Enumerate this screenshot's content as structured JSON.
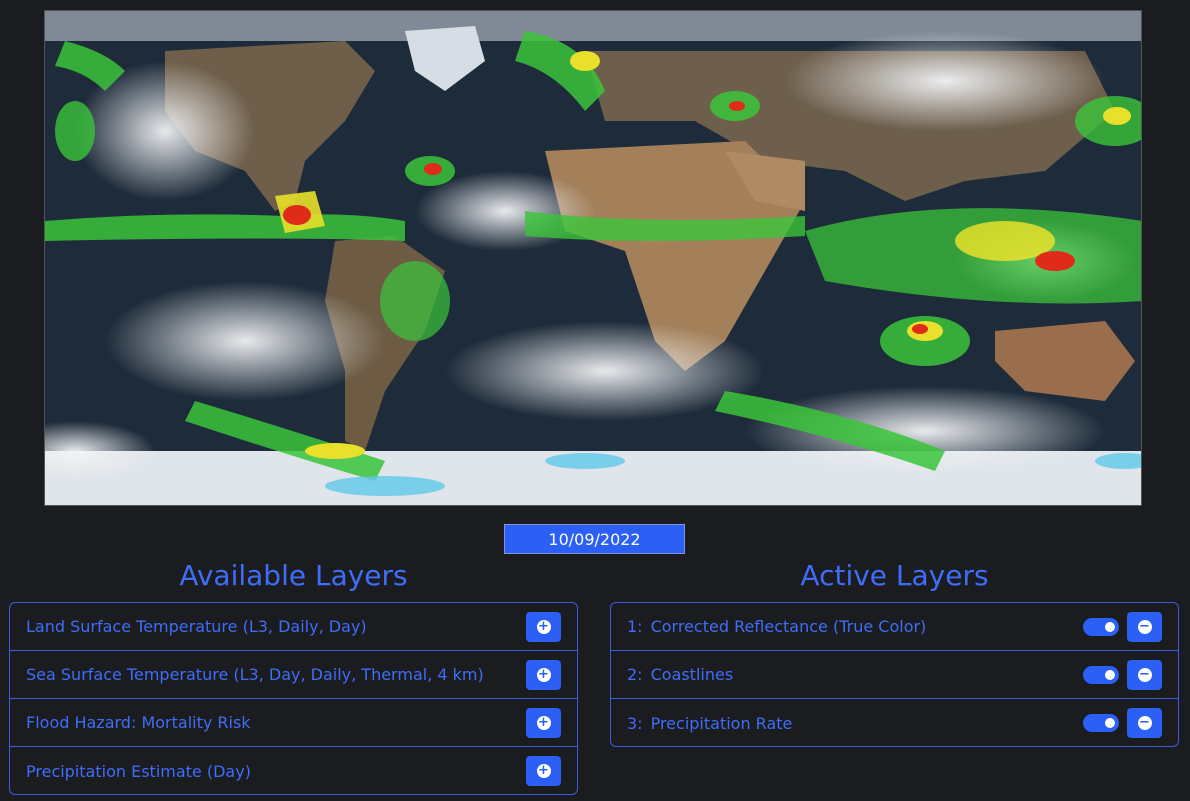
{
  "map": {
    "description_icon": "world-map-icon"
  },
  "date": {
    "value": "10/09/2022"
  },
  "available": {
    "title": "Available Layers",
    "items": [
      {
        "label": "Land Surface Temperature (L3, Daily, Day)",
        "action_icon": "plus-circle-icon"
      },
      {
        "label": "Sea Surface Temperature (L3, Day, Daily, Thermal, 4 km)",
        "action_icon": "plus-circle-icon"
      },
      {
        "label": "Flood Hazard: Mortality Risk",
        "action_icon": "plus-circle-icon"
      },
      {
        "label": "Precipitation Estimate (Day)",
        "action_icon": "plus-circle-icon"
      }
    ]
  },
  "active": {
    "title": "Active Layers",
    "items": [
      {
        "index": "1:",
        "label": "Corrected Reflectance (True Color)",
        "enabled": true,
        "action_icon": "minus-circle-icon"
      },
      {
        "index": "2:",
        "label": "Coastlines",
        "enabled": true,
        "action_icon": "minus-circle-icon"
      },
      {
        "index": "3:",
        "label": "Precipitation Rate",
        "enabled": true,
        "action_icon": "minus-circle-icon"
      }
    ]
  },
  "colors": {
    "accent": "#2b5ff5",
    "text_accent": "#3f6df7",
    "background": "#1b1c20",
    "land": "#7a6650",
    "desert": "#b08a62",
    "precip_green": "#3bc43b",
    "precip_yellow": "#e8e02a",
    "precip_red": "#e02a1a",
    "cloud": "#e8ecf0"
  }
}
